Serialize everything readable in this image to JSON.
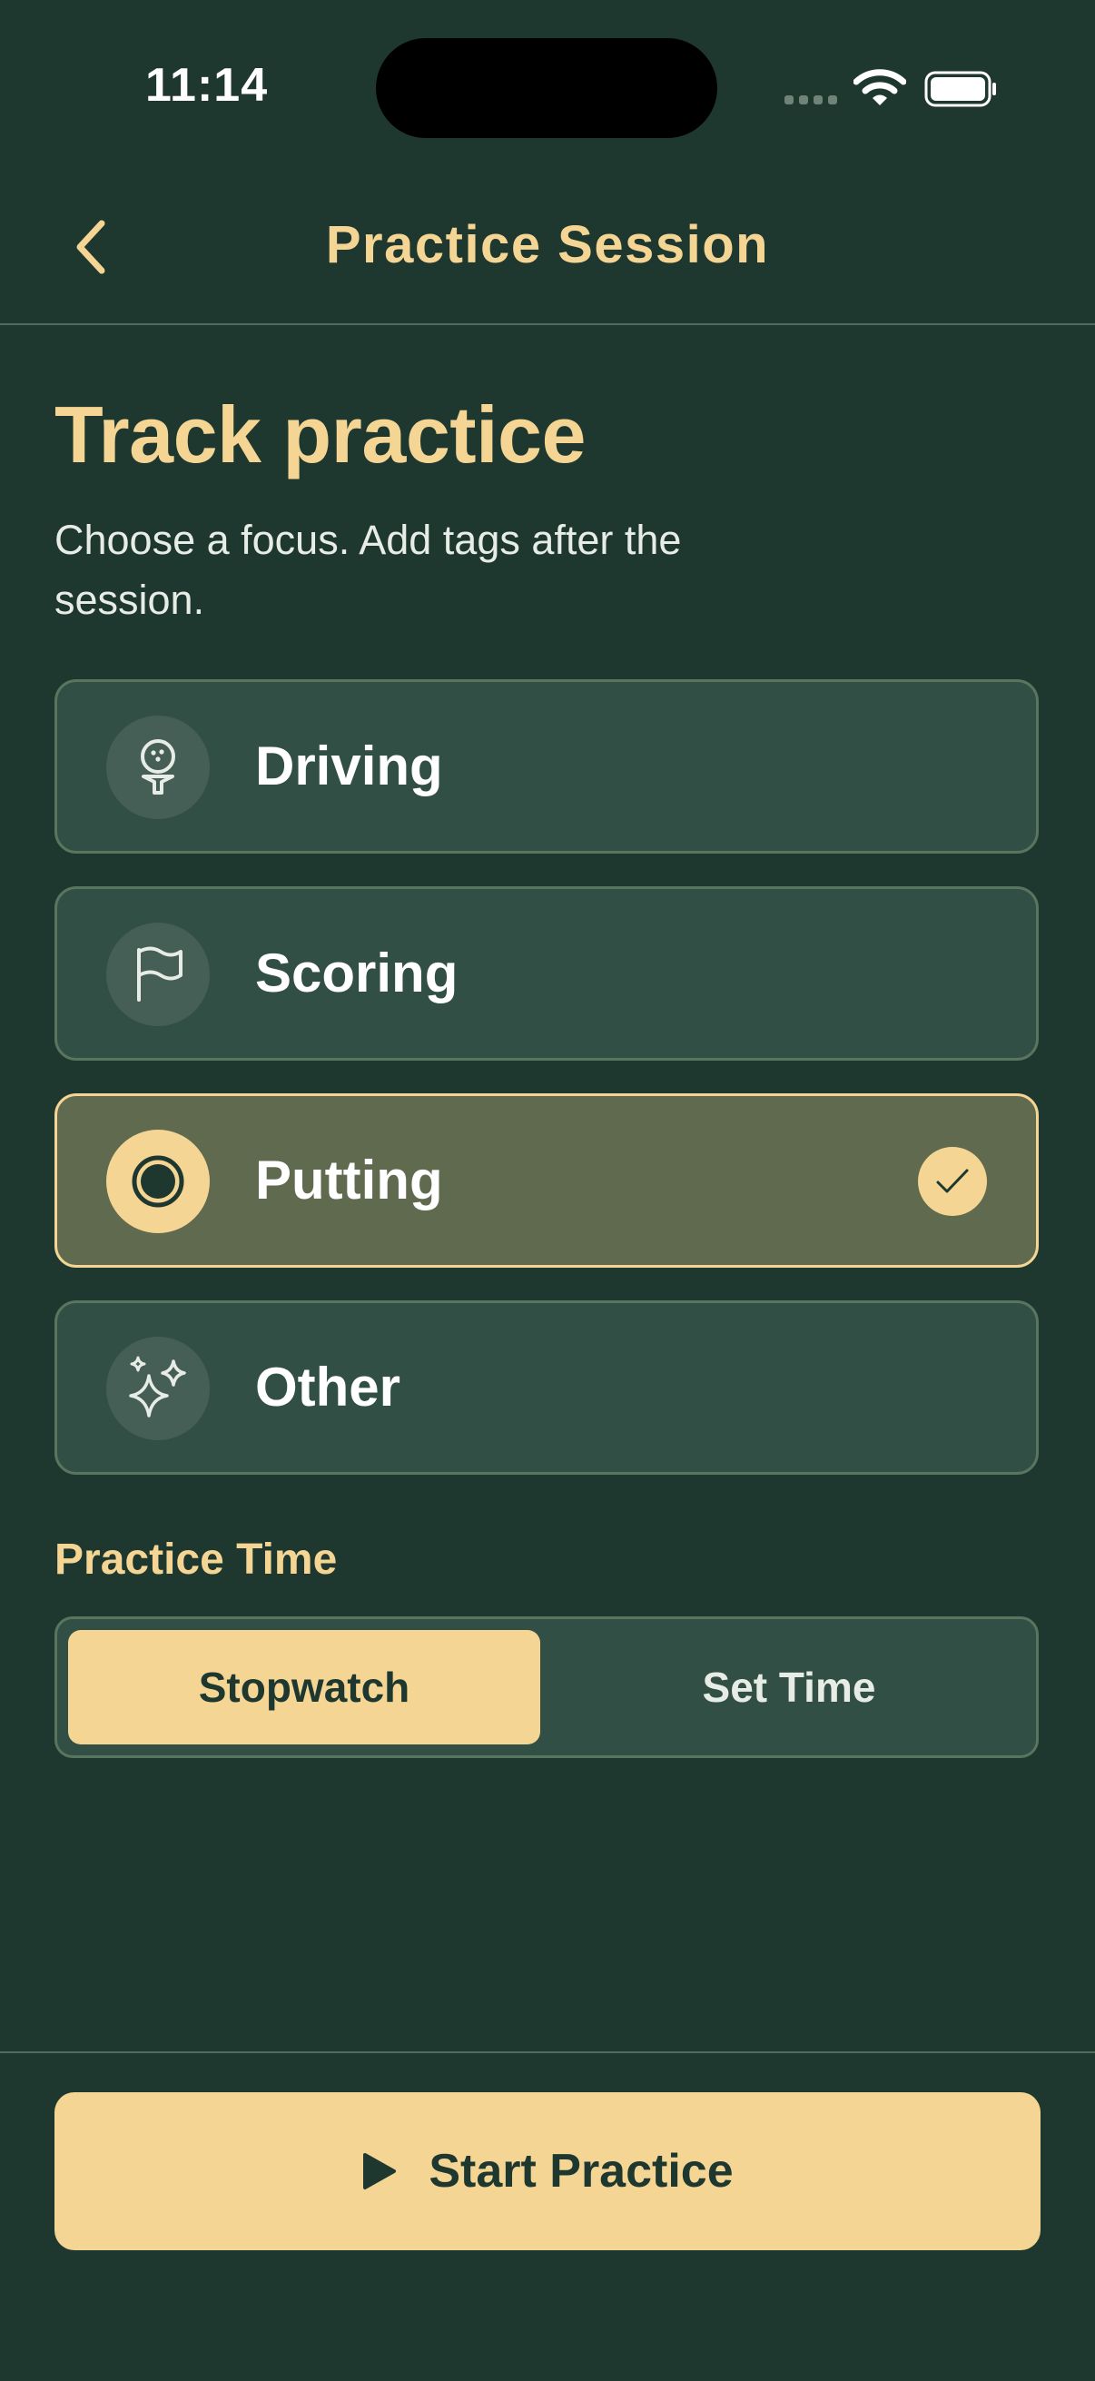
{
  "status_bar": {
    "time": "11:14"
  },
  "nav": {
    "back_icon": "chevron-left-icon",
    "title": "Practice Session"
  },
  "header": {
    "title": "Track practice",
    "subtitle": "Choose a focus. Add tags after the session."
  },
  "focus_options": [
    {
      "label": "Driving",
      "icon": "golf-ball-tee-icon",
      "selected": false
    },
    {
      "label": "Scoring",
      "icon": "flag-icon",
      "selected": false
    },
    {
      "label": "Putting",
      "icon": "target-icon",
      "selected": true
    },
    {
      "label": "Other",
      "icon": "sparkles-icon",
      "selected": false
    }
  ],
  "practice_time": {
    "label": "Practice Time",
    "options": [
      "Stopwatch",
      "Set Time"
    ],
    "selected": "Stopwatch"
  },
  "cta": {
    "label": "Start Practice",
    "icon": "play-icon"
  },
  "colors": {
    "background": "#1e3830",
    "accent": "#f5d593",
    "card": "#324f45",
    "card_selected": "#5f6a4f",
    "border": "#58755f"
  }
}
